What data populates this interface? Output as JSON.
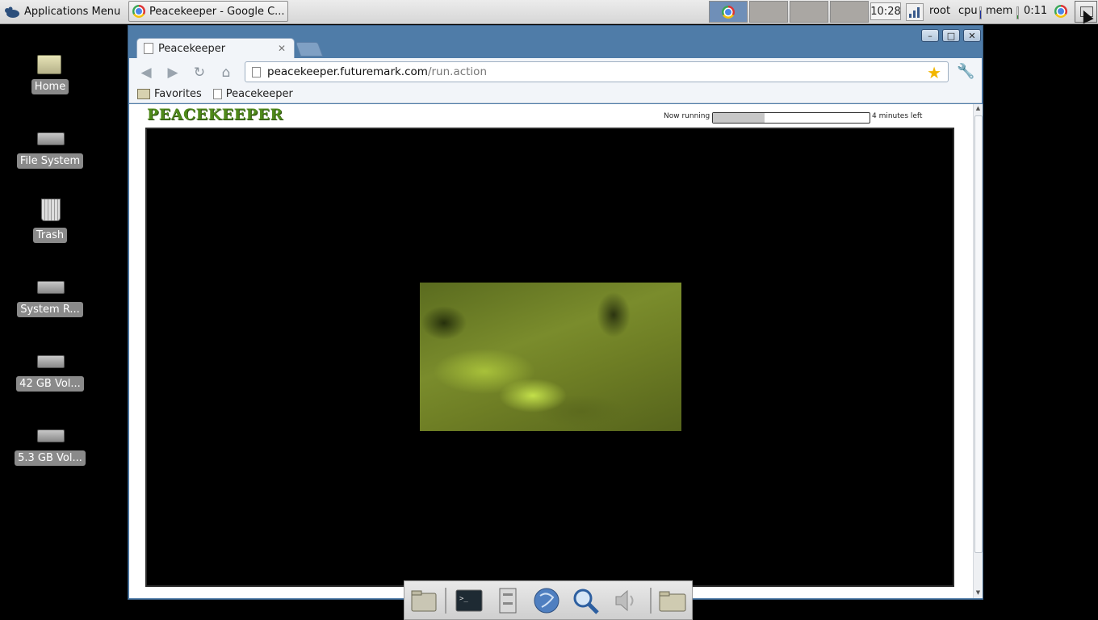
{
  "panel": {
    "apps_menu": "Applications Menu",
    "task_title": "Peacekeeper - Google C...",
    "clock_time": "10:28",
    "user": "root",
    "cpu_label": "cpu",
    "mem_label": "mem",
    "uptime": "0:11"
  },
  "desktop": {
    "icons": [
      {
        "label": "Home"
      },
      {
        "label": "File System"
      },
      {
        "label": "Trash"
      },
      {
        "label": "System R..."
      },
      {
        "label": "42 GB Vol..."
      },
      {
        "label": "5.3 GB Vol..."
      }
    ]
  },
  "browser": {
    "tab_title": "Peacekeeper",
    "url_host": "peacekeeper.futuremark.com",
    "url_path": "/run.action",
    "bookmarks": [
      "Favorites",
      "Peacekeeper"
    ]
  },
  "page": {
    "logo": "PEACEKEEPER",
    "status_label": "Now running",
    "progress_fraction": 0.33,
    "time_left": "4 minutes left"
  },
  "colors": {
    "accent": "#4f7ca8",
    "logo_green": "#4f8a1a",
    "star": "#f2b600"
  }
}
